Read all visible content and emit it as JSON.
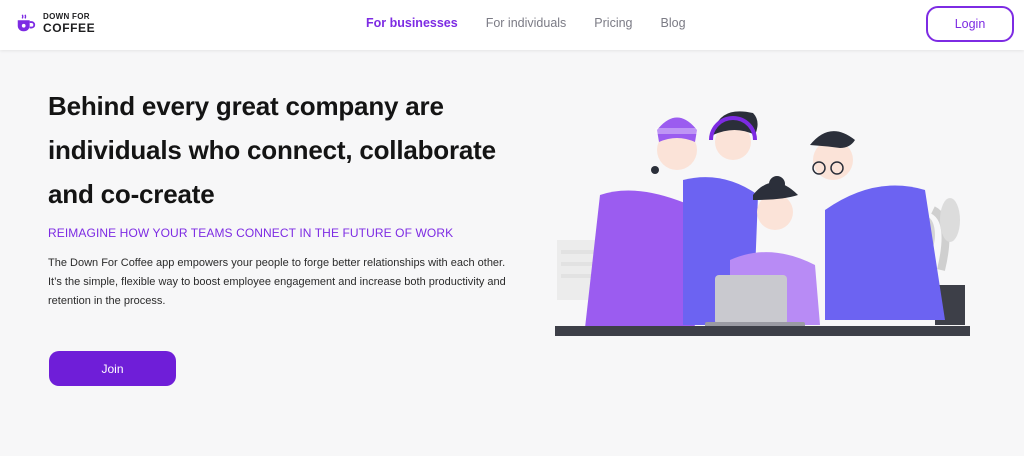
{
  "brand": {
    "line1": "DOWN FOR",
    "line2": "COFFEE",
    "icon": "coffee-cup-icon",
    "accent": "#7d2be3"
  },
  "nav": {
    "links": [
      {
        "label": "For businesses",
        "active": true
      },
      {
        "label": "For individuals",
        "active": false
      },
      {
        "label": "Pricing",
        "active": false
      },
      {
        "label": "Blog",
        "active": false
      }
    ],
    "login_label": "Login"
  },
  "hero": {
    "title": "Behind every great company are individuals who connect, collaborate and co-create",
    "subtitle": "REIMAGINE HOW YOUR TEAMS CONNECT IN THE FUTURE OF WORK",
    "body": "The Down For Coffee app empowers your people to forge better relationships with each other. It’s the simple, flexible way to boost employee engagement and increase both productivity and retention in the process.",
    "join_label": "Join"
  },
  "illustration": {
    "name": "team-collaborating-illustration",
    "colors": {
      "purple": "#9b5cf0",
      "blue": "#6c63f2",
      "dark": "#2b2f3a"
    }
  }
}
